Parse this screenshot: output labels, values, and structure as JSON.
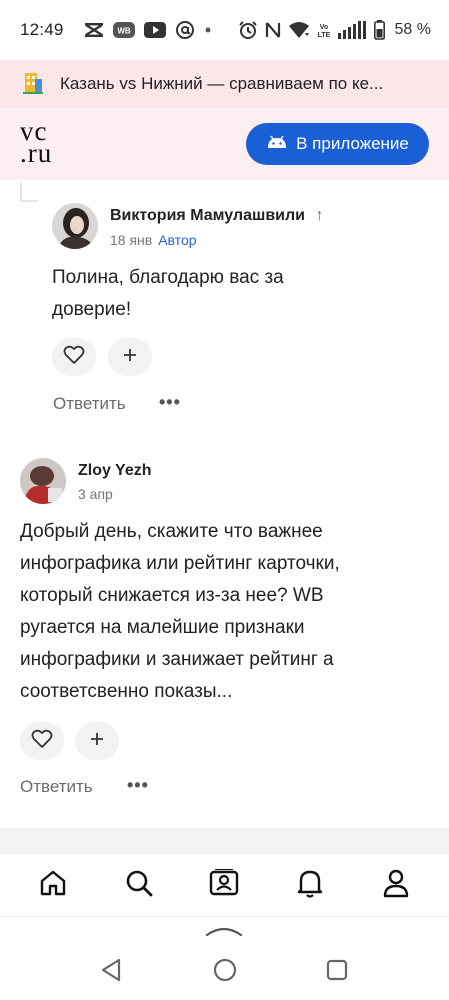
{
  "status_bar": {
    "time": "12:49",
    "battery": "58 %",
    "left_icons": [
      "capcut-icon",
      "wb-icon",
      "youtube-icon",
      "at-icon",
      "dot-icon"
    ],
    "right_icons": [
      "alarm-icon",
      "nfc-icon",
      "wifi-icon",
      "volte-icon",
      "signal-icon",
      "battery-icon"
    ],
    "volte_label": "Vo LTE",
    "wb_label": "WB"
  },
  "banner": {
    "title": "Казань vs Нижний — сравниваем по ке..."
  },
  "header": {
    "logo_line1": "vc",
    "logo_line2": ".ru",
    "app_button": "В приложение",
    "brand_color": "#1a5fd6"
  },
  "comments": [
    {
      "author": "Виктория Мамулашвили",
      "author_arrow": "↑",
      "date": "18 янв",
      "badge": "Автор",
      "text_lines": [
        "Полина, благодарю вас за",
        "доверие!"
      ],
      "reply": "Ответить",
      "more": "•••"
    },
    {
      "author": "Zloy Yezh",
      "date": "3 апр",
      "text_lines": [
        "Добрый день, скажите что важнее",
        "инфографика или рейтинг карточки,",
        "который снижается из-за нее? WB",
        "ругается на малейшие признаки",
        "инфографики и занижает рейтинг а",
        "соответсвенно показы..."
      ],
      "reply": "Ответить",
      "more": "•••"
    }
  ],
  "bottom_nav": [
    "home-icon",
    "search-icon",
    "profile-card-icon",
    "bell-icon",
    "user-icon"
  ]
}
